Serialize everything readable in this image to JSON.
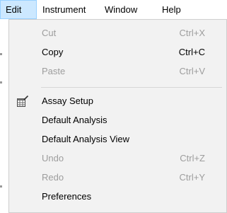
{
  "menubar": {
    "items": [
      {
        "label": "Edit"
      },
      {
        "label": "Instrument"
      },
      {
        "label": "Window"
      },
      {
        "label": "Help"
      }
    ]
  },
  "edit_menu": {
    "items": [
      {
        "label": "Cut",
        "shortcut": "Ctrl+X",
        "enabled": false
      },
      {
        "label": "Copy",
        "shortcut": "Ctrl+C",
        "enabled": true
      },
      {
        "label": "Paste",
        "shortcut": "Ctrl+V",
        "enabled": false
      },
      {
        "label": "Assay Setup",
        "shortcut": "",
        "enabled": true,
        "icon": "assay-setup-icon"
      },
      {
        "label": "Default Analysis",
        "shortcut": "",
        "enabled": true
      },
      {
        "label": "Default Analysis View",
        "shortcut": "",
        "enabled": true
      },
      {
        "label": "Undo",
        "shortcut": "Ctrl+Z",
        "enabled": false
      },
      {
        "label": "Redo",
        "shortcut": "Ctrl+Y",
        "enabled": false
      },
      {
        "label": "Preferences",
        "shortcut": "",
        "enabled": true
      }
    ]
  },
  "colors": {
    "menu_background": "#f2f2f2",
    "open_menu_highlight": "#cce8ff",
    "disabled_text": "#9d9d9d"
  }
}
